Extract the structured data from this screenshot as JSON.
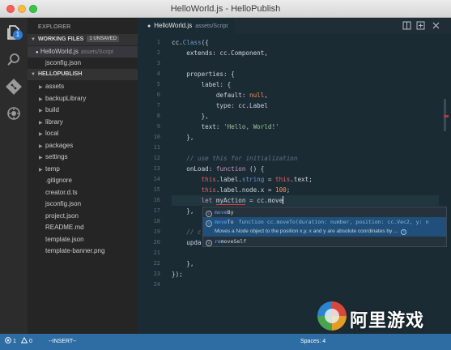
{
  "window": {
    "title": "HelloWorld.js - HelloPublish"
  },
  "activity_bar": {
    "items": [
      {
        "name": "explorer-icon",
        "badge": "1"
      },
      {
        "name": "search-icon"
      },
      {
        "name": "git-icon"
      },
      {
        "name": "debug-icon"
      }
    ]
  },
  "sidebar": {
    "title": "EXPLORER",
    "working_files": {
      "label": "WORKING FILES",
      "badge": "1 UNSAVED",
      "files": [
        {
          "name": "HelloWorld.js",
          "path": "assets/Script",
          "dirty": true
        },
        {
          "name": "jsconfig.json",
          "path": ""
        }
      ]
    },
    "project": {
      "label": "HELLOPUBLISH",
      "folders": [
        "assets",
        "backupLibrary",
        "build",
        "library",
        "local",
        "packages",
        "settings",
        "temp"
      ],
      "files": [
        ".gitignore",
        "creator.d.ts",
        "jsconfig.json",
        "project.json",
        "README.md",
        "template.json",
        "template-banner.png"
      ]
    }
  },
  "editor": {
    "tab": {
      "name": "HelloWorld.js",
      "path": "assets/Script",
      "dirty_marker": "●"
    },
    "line_numbers": [
      "1",
      "2",
      "3",
      "4",
      "5",
      "6",
      "7",
      "8",
      "9",
      "10",
      "11",
      "12",
      "13",
      "14",
      "15",
      "16",
      "17",
      "18",
      "19",
      "20",
      "21",
      "22",
      "23",
      "24"
    ],
    "suggest": {
      "items": [
        {
          "match": "move",
          "rest": "By"
        },
        {
          "match": "move",
          "rest": "To",
          "detail": "function cc.moveTo(duration: number, position: cc.Vec2, y: n",
          "doc": "Moves a Node object to the position x,y. x and y are absolute coordinates by ..."
        },
        {
          "match": "re",
          "rest": "moveSelf",
          "prefix_match": ""
        }
      ]
    }
  },
  "statusbar": {
    "errors": "1",
    "warnings": "0",
    "mode": "--INSERT--",
    "spaces": "Spaces: 4",
    "right_partial": "—"
  },
  "watermark": {
    "text": "阿里游戏"
  },
  "colors": {
    "statusbar": "#2d6da3",
    "editor_bg": "#1b2b34",
    "sidebar_bg": "#252526",
    "keyword": "#c594c5",
    "string": "#99c794",
    "number": "#f99157"
  }
}
